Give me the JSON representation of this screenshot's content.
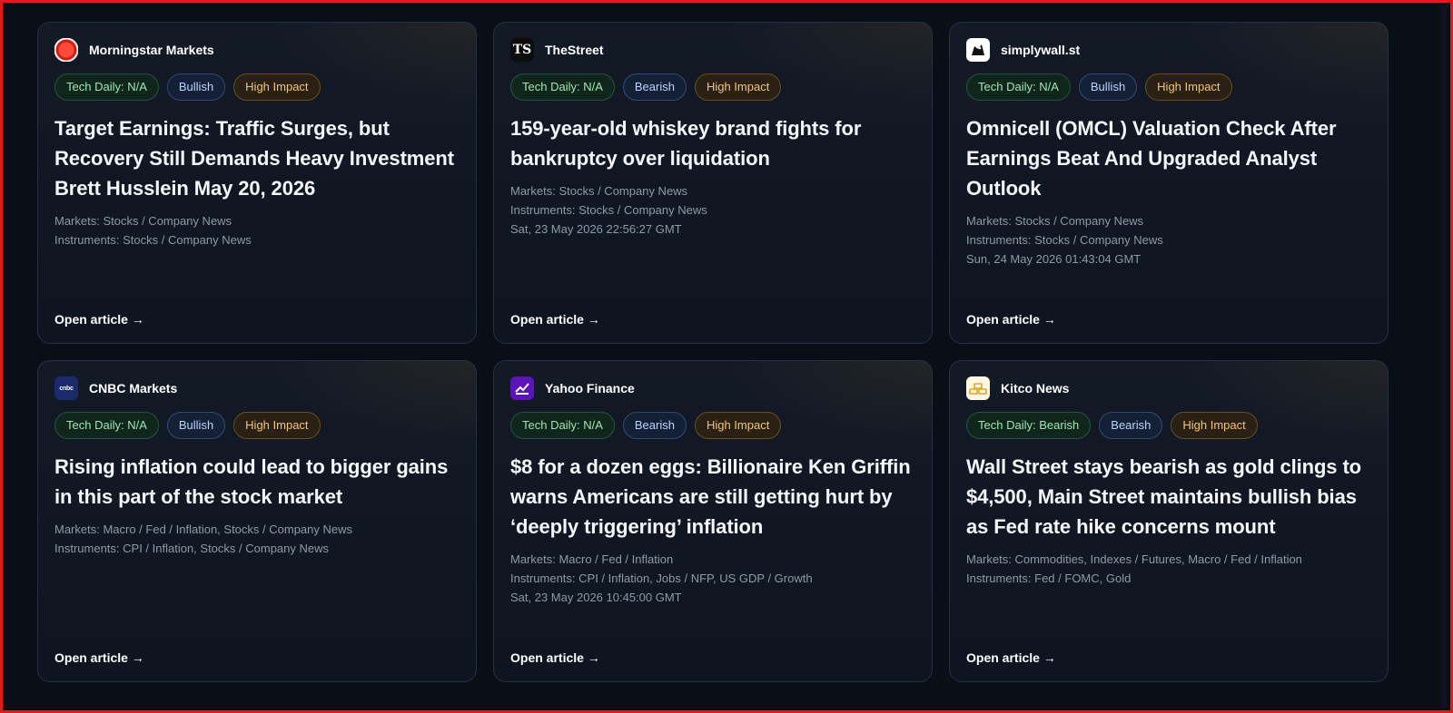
{
  "cards": [
    {
      "source": "Morningstar Markets",
      "logo_icon": "morningstar-logo-icon",
      "tags": {
        "tech": "Tech Daily: N/A",
        "direction": "Bullish",
        "impact": "High Impact"
      },
      "title": "Target Earnings: Traffic Surges, but Recovery Still Demands Heavy Investment Brett Husslein May 20, 2026",
      "meta": [
        "Markets: Stocks / Company News",
        "Instruments: Stocks / Company News"
      ],
      "link": "Open article →"
    },
    {
      "source": "TheStreet",
      "logo_icon": "thestreet-logo-icon",
      "logo_text": "TS",
      "tags": {
        "tech": "Tech Daily: N/A",
        "direction": "Bearish",
        "impact": "High Impact"
      },
      "title": "159-year-old whiskey brand fights for bankruptcy over liquidation",
      "meta": [
        "Markets: Stocks / Company News",
        "Instruments: Stocks / Company News",
        "Sat, 23 May 2026 22:56:27 GMT"
      ],
      "link": "Open article →"
    },
    {
      "source": "simplywall.st",
      "logo_icon": "simplywallst-logo-icon",
      "tags": {
        "tech": "Tech Daily: N/A",
        "direction": "Bullish",
        "impact": "High Impact"
      },
      "title": "Omnicell (OMCL) Valuation Check After Earnings Beat And Upgraded Analyst Outlook",
      "meta": [
        "Markets: Stocks / Company News",
        "Instruments: Stocks / Company News",
        "Sun, 24 May 2026 01:43:04 GMT"
      ],
      "link": "Open article →"
    },
    {
      "source": "CNBC Markets",
      "logo_icon": "cnbc-logo-icon",
      "logo_text": "cnbc",
      "tags": {
        "tech": "Tech Daily: N/A",
        "direction": "Bullish",
        "impact": "High Impact"
      },
      "title": "Rising inflation could lead to bigger gains in this part of the stock market",
      "meta": [
        "Markets: Macro / Fed / Inflation, Stocks / Company News",
        "Instruments: CPI / Inflation, Stocks / Company News"
      ],
      "link": "Open article →"
    },
    {
      "source": "Yahoo Finance",
      "logo_icon": "yahoo-finance-logo-icon",
      "tags": {
        "tech": "Tech Daily: N/A",
        "direction": "Bearish",
        "impact": "High Impact"
      },
      "title": "$8 for a dozen eggs: Billionaire Ken Griffin warns Americans are still getting hurt by ‘deeply triggering’ inflation",
      "meta": [
        "Markets: Macro / Fed / Inflation",
        "Instruments: CPI / Inflation, Jobs / NFP, US GDP / Growth",
        "Sat, 23 May 2026 10:45:00 GMT"
      ],
      "link": "Open article →"
    },
    {
      "source": "Kitco News",
      "logo_icon": "kitco-logo-icon",
      "tags": {
        "tech": "Tech Daily: Bearish",
        "direction": "Bearish",
        "impact": "High Impact"
      },
      "title": "Wall Street stays bearish as gold clings to $4,500, Main Street maintains bullish bias as Fed rate hike concerns mount",
      "meta": [
        "Markets: Commodities, Indexes / Futures, Macro / Fed / Inflation",
        "Instruments: Fed / FOMC, Gold"
      ],
      "link": "Open article →"
    }
  ]
}
